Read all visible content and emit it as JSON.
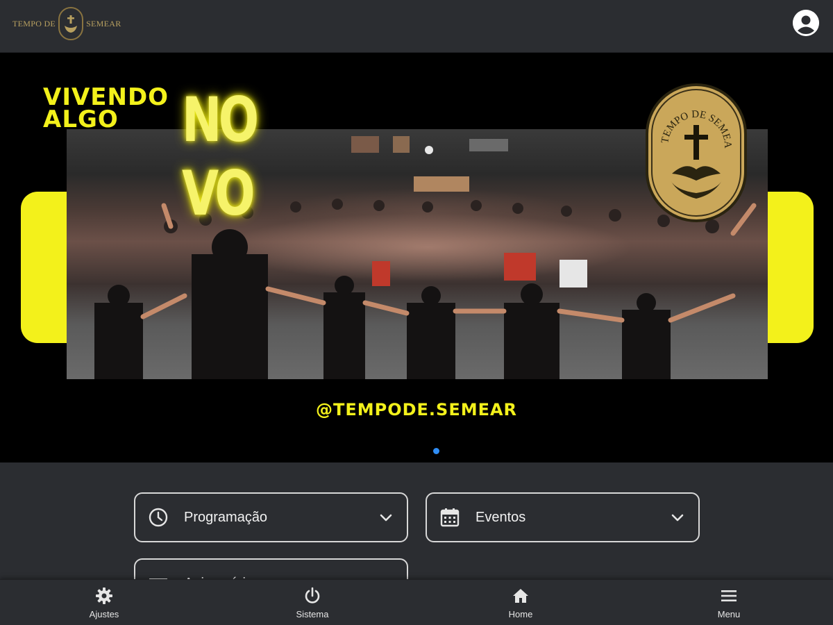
{
  "header": {
    "logo_text_left": "TEMPO DE",
    "logo_text_right": "SEMEAR",
    "profile_icon": "account-circle-icon"
  },
  "banner": {
    "headline_line1": "VIVENDO",
    "headline_line2": "ALGO",
    "neon_line1": "NO",
    "neon_line2": "VO",
    "seal_text": "TEMPO DE SEMEAR",
    "handle": "@TEMPODE.SEMEAR",
    "accent_color": "#f3f11b",
    "carousel": {
      "current": 1,
      "total": 1,
      "dot_color": "#2f8df5"
    }
  },
  "cards": [
    {
      "label": "Programação",
      "icon": "clock-icon"
    },
    {
      "label": "Eventos",
      "icon": "calendar-icon"
    },
    {
      "label": "Aniversários",
      "icon": "gift-icon"
    }
  ],
  "bottom_nav": [
    {
      "label": "Ajustes",
      "icon": "gear-icon"
    },
    {
      "label": "Sistema",
      "icon": "power-icon"
    },
    {
      "label": "Home",
      "icon": "home-icon"
    },
    {
      "label": "Menu",
      "icon": "hamburger-menu-icon"
    }
  ]
}
